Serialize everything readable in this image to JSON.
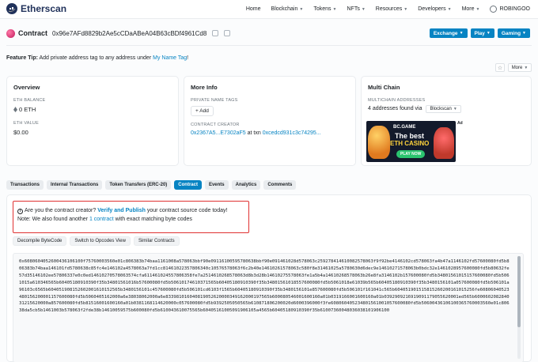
{
  "header": {
    "brand": "Etherscan",
    "nav": [
      {
        "label": "Home",
        "has_dropdown": false
      },
      {
        "label": "Blockchain",
        "has_dropdown": true
      },
      {
        "label": "Tokens",
        "has_dropdown": true
      },
      {
        "label": "NFTs",
        "has_dropdown": true
      },
      {
        "label": "Resources",
        "has_dropdown": true
      },
      {
        "label": "Developers",
        "has_dropdown": true
      },
      {
        "label": "More",
        "has_dropdown": true
      }
    ],
    "user": "ROBINGOO"
  },
  "contract": {
    "title": "Contract",
    "address": "0x96e7AFd8829b2Ae5cCDaABeA04B63cBDf4961Cd8",
    "buttons": {
      "exchange": "Exchange",
      "play": "Play",
      "gaming": "Gaming"
    }
  },
  "feature_tip": {
    "label": "Feature Tip:",
    "text": "Add private address tag to any address under",
    "link": "My Name Tag",
    "suffix": "!"
  },
  "top_actions": {
    "more": "More"
  },
  "overview": {
    "title": "Overview",
    "eth_balance_label": "ETH BALANCE",
    "eth_balance_value": "0 ETH",
    "eth_value_label": "ETH VALUE",
    "eth_value_value": "$0.00"
  },
  "more_info": {
    "title": "More Info",
    "private_tags_label": "PRIVATE NAME TAGS",
    "add_button": "+ Add",
    "creator_label": "CONTRACT CREATOR",
    "creator_address": "0x2367A5...E7302aF5",
    "at_txn": "at txn",
    "creator_txn": "0xcedcd931c3c74295..."
  },
  "multi_chain": {
    "title": "Multi Chain",
    "addresses_label": "MULTICHAIN ADDRESSES",
    "addresses_text": "4 addresses found via",
    "source": "Blockscan",
    "ad": {
      "logo": "BC.GAME",
      "headline": "The best",
      "subline": "ETH CASINO",
      "cta": "PLAY NOW",
      "badge": "Ad"
    }
  },
  "tabs": [
    {
      "label": "Transactions",
      "active": false
    },
    {
      "label": "Internal Transactions",
      "active": false
    },
    {
      "label": "Token Transfers (ERC-20)",
      "active": false
    },
    {
      "label": "Contract",
      "active": true
    },
    {
      "label": "Events",
      "active": false
    },
    {
      "label": "Analytics",
      "active": false
    },
    {
      "label": "Comments",
      "active": false
    }
  ],
  "alert": {
    "question": "Are you the contract creator?",
    "link": "Verify and Publish",
    "rest": "your contract source code today!",
    "note_prefix": "Note: We also found another",
    "note_link": "1 contract",
    "note_suffix": "with exact matching byte codes"
  },
  "code_actions": [
    "Decompile ByteCode",
    "Switch to Opcodes View",
    "Similar Contracts"
  ],
  "bytecode": "0x6080604052600436106100f75760003560e01c806383b74baa1161008a578063bbf90e09116100595780638bbf90e091461028d578063c259278414610082578063f9f92be4146102cd578063fa4b47a1146102fd57600080fd5b806383b74baa146101fd5780638c85fc4e146102a4578063a7fd1cc81461022357806340c10576578063f6c2b40e14610261578063c580f8e31461025a5780630d6dec9e14610271578063b0bdc32e1461028957600080fd5b80632fe57d35146102ee57806337e0c0ed14610270578063574cfa611461024557806358fe7a2514610268578063d8b3d28b14610275578063fe1a5b4a14610268578063b26e8fa3146102b157600080fd5b34801561015157600080fd5b5061015a610346565b60405180910390f35b34801561016b57600080fd5b50610174610371565b60405180910390f35b34801561018557600080fd5b5061018e61039b565b60405180910390f35b3480156101a057600080fd5b506101a96103c6565b604051908152602001610152565b3480156101c457600080fd5b506101cd6103f1565b60405180910390f35b3480156101e857600080fd5b506101f161041c565b604051901515815260200161015256fe60806040523480156200001157600080fd5b5060405162000a6e38038062000a6e833981016040819052620000349162000197565b600080546001600160a01b0319166001600160a01b0392909216919091179055620001ed565b600060208284031215620000a857600080fd5b81516001600160a01b0381168114620000c057600080fd5b9392505050565b610871806200020d6000396000f3fe608060405234801561001057600080fd5b50600436106100365760003560e01c80638da5cb5b1461003b578063f2fde38b14610059575b600080fd5b610043610075565b60405161005091906105a4565b60405180910390f35b61007360048036038101906100"
}
